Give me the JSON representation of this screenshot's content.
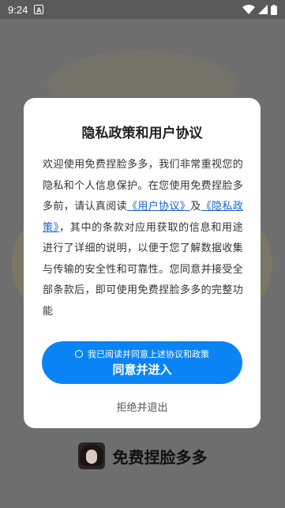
{
  "status_bar": {
    "time": "9:24",
    "notification_icon": "a-icon",
    "wifi_icon": "wifi-icon",
    "signal_icon": "signal-icon",
    "battery_icon": "battery-icon"
  },
  "dialog": {
    "title": "隐私政策和用户协议",
    "body_intro": "欢迎使用免费捏脸多多，我们非常重视您的隐私和个人信息保护。在您使用免费捏脸多多前，请认真阅读",
    "user_agreement_link": "《用户协议》",
    "and_text": "及",
    "privacy_policy_link": "《隐私政策》",
    "body_rest": "，其中的条款对应用获取的信息和用途进行了详细的说明，以便于您了解数据收集与传输的安全性和可靠性。您同意并接受全部条款后，即可使用免费捏脸多多的完整功能",
    "consent_checkbox_label": "我已阅读并同意上述协议和政策",
    "agree_button_label": "同意并进入",
    "reject_label": "拒绝并退出"
  },
  "app": {
    "name": "免费捏脸多多",
    "logo_icon": "app-logo-icon"
  },
  "colors": {
    "accent": "#0a84f5",
    "link": "#1a5fd1",
    "overlay_bg": "#6e6e6e"
  }
}
